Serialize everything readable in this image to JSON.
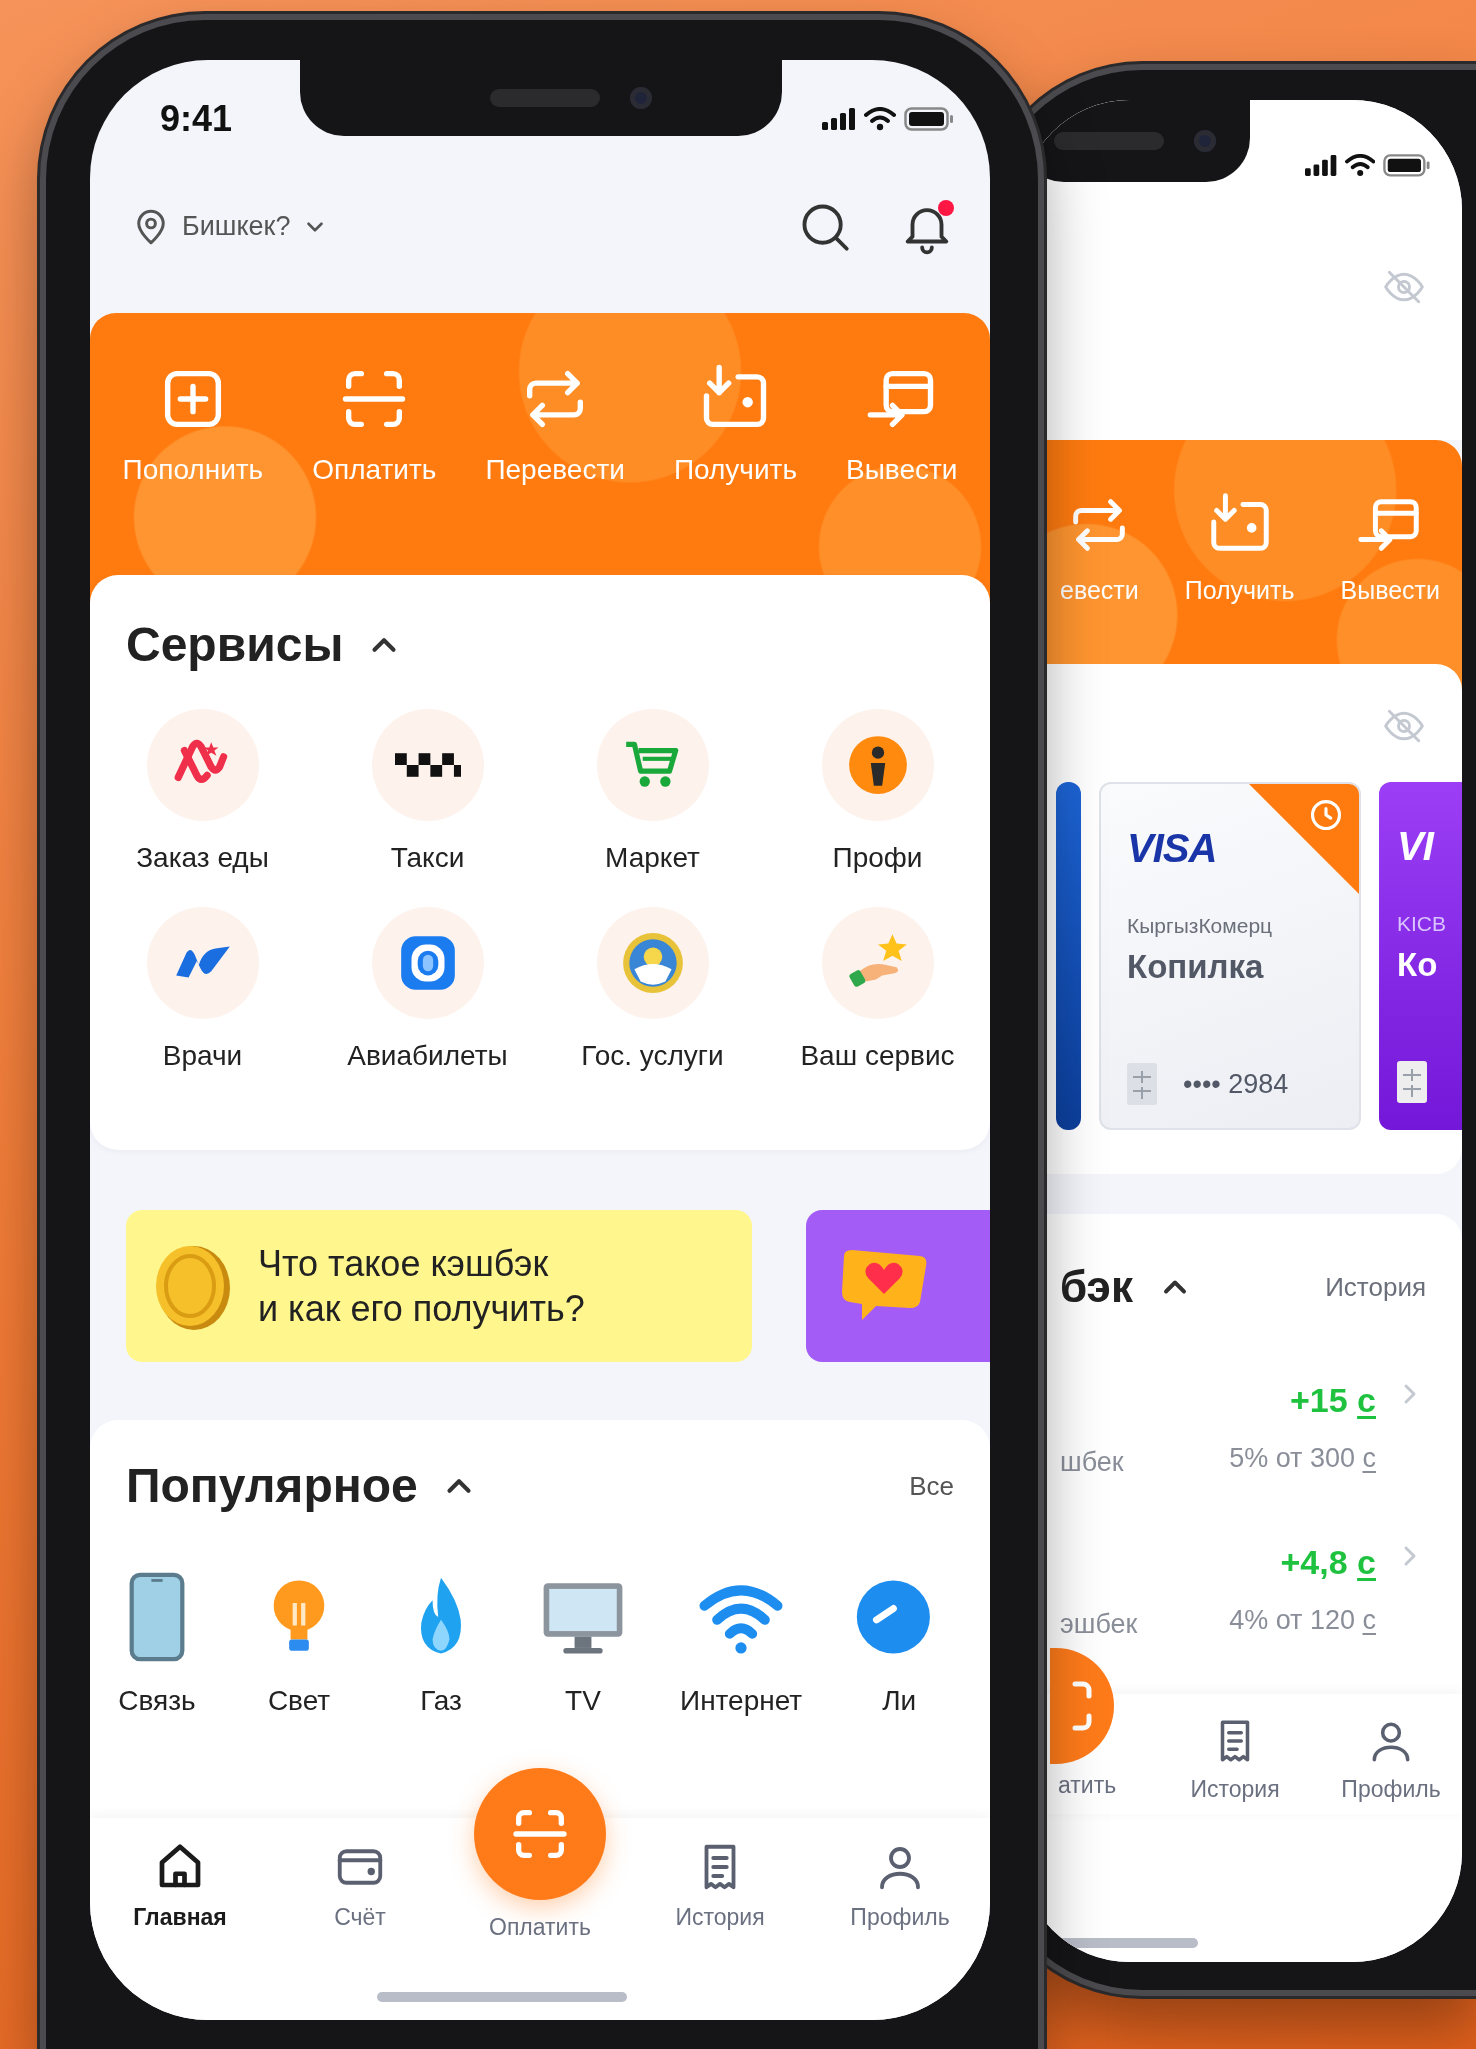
{
  "front_phone": {
    "status_bar": {
      "time": "9:41"
    },
    "location": {
      "city": "Бишкек?"
    },
    "notifications": {
      "unread": true
    },
    "actions": [
      {
        "kind": "topup",
        "label": "Пополнить"
      },
      {
        "kind": "pay",
        "label": "Оплатить"
      },
      {
        "kind": "transfer",
        "label": "Перевести"
      },
      {
        "kind": "receive",
        "label": "Получить"
      },
      {
        "kind": "withdraw",
        "label": "Вывести"
      }
    ],
    "services": {
      "title": "Сервисы",
      "expanded": true,
      "items": [
        {
          "kind": "food",
          "label": "Заказ еды"
        },
        {
          "kind": "taxi",
          "label": "Такси"
        },
        {
          "kind": "market",
          "label": "Маркет"
        },
        {
          "kind": "profi",
          "label": "Профи"
        },
        {
          "kind": "doctors",
          "label": "Врачи"
        },
        {
          "kind": "flights",
          "label": "Авиабилеты"
        },
        {
          "kind": "gov",
          "label": "Гос. услуги"
        },
        {
          "kind": "custom",
          "label": "Ваш сервис"
        }
      ]
    },
    "banners": [
      {
        "kind": "cashback",
        "text": "Что такое кэшбэк\nи как его получить?"
      },
      {
        "kind": "heart"
      }
    ],
    "popular": {
      "title": "Популярное",
      "expanded": true,
      "all_link": "Все",
      "items": [
        {
          "kind": "mobile",
          "label": "Связь"
        },
        {
          "kind": "light",
          "label": "Свет"
        },
        {
          "kind": "gas",
          "label": "Газ"
        },
        {
          "kind": "tv",
          "label": "TV"
        },
        {
          "kind": "internet",
          "label": "Интернет"
        },
        {
          "kind": "other",
          "label": "Ли"
        }
      ]
    },
    "tab_bar": [
      {
        "kind": "home",
        "label": "Главная",
        "selected": true
      },
      {
        "kind": "account",
        "label": "Счёт",
        "selected": false
      },
      {
        "kind": "pay",
        "label": "Оплатить",
        "selected": false
      },
      {
        "kind": "history",
        "label": "История",
        "selected": false
      },
      {
        "kind": "profile",
        "label": "Профиль",
        "selected": false
      }
    ]
  },
  "back_phone": {
    "actions": [
      {
        "kind": "transfer",
        "label": "евести"
      },
      {
        "kind": "receive",
        "label": "Получить"
      },
      {
        "kind": "withdraw",
        "label": "Вывести"
      }
    ],
    "cards": [
      {
        "kind": "blue"
      },
      {
        "kind": "light",
        "brand": "VISA",
        "bank": "КыргызКомерц",
        "name": "Копилка",
        "number": "•••• 2984",
        "timer": true
      },
      {
        "kind": "purple",
        "brand": "VI",
        "bank": "KICB",
        "name": "Ко"
      }
    ],
    "cashback": {
      "title": "бэк",
      "expanded": true,
      "history_link": "История",
      "rows": [
        {
          "label": "шбек",
          "amount": "+15",
          "currency": "с",
          "detail": "5% от 300",
          "detail_currency": "с"
        },
        {
          "label": "эшбек",
          "amount": "+4,8",
          "currency": "с",
          "detail": "4% от 120",
          "detail_currency": "с"
        }
      ]
    },
    "tab_bar": [
      {
        "kind": "pay",
        "label": "атить",
        "selected": false
      },
      {
        "kind": "history",
        "label": "История",
        "selected": false
      },
      {
        "kind": "profile",
        "label": "Профиль",
        "selected": false
      }
    ]
  }
}
